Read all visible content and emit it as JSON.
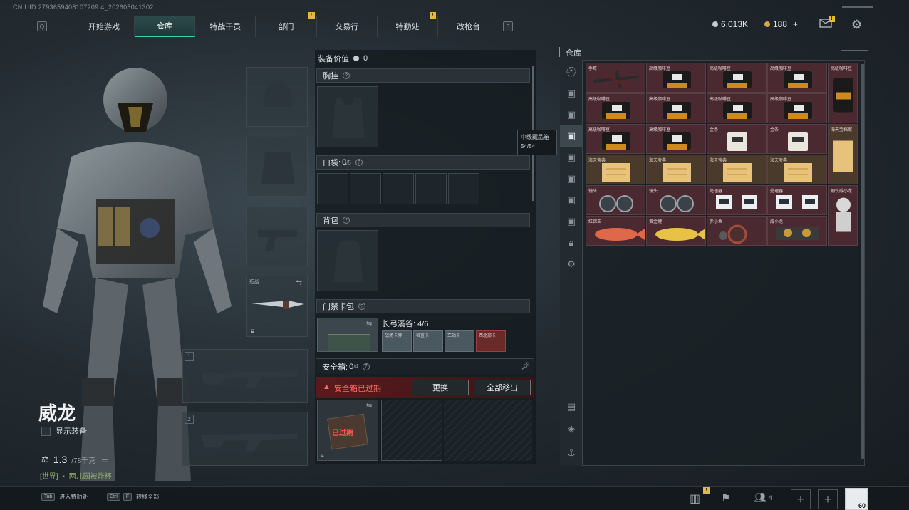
{
  "uid_text": "CN UID:2793659408107209 4_202605041302",
  "nav": {
    "left_key": "Q",
    "right_key": "E",
    "tabs": [
      {
        "label": "开始游戏",
        "badge": ""
      },
      {
        "label": "仓库",
        "badge": "",
        "active": true
      },
      {
        "label": "特战干员",
        "badge": ""
      },
      {
        "label": "部门",
        "badge": "!"
      },
      {
        "label": "交易行",
        "badge": ""
      },
      {
        "label": "特勤处",
        "badge": "!"
      },
      {
        "label": "改枪台",
        "badge": ""
      }
    ]
  },
  "currency": {
    "coins": "6,013K",
    "bonds": "188",
    "plus": "+",
    "mail_badge": "!"
  },
  "character": {
    "name": "威龙",
    "show_equipment_label": "显示装备",
    "weight_value": "1.3",
    "weight_max": "/78千克",
    "chat_channel": "[世界]",
    "chat_text": "两儿园被炸杯",
    "knife_label": "近战",
    "slot1_num": "1",
    "slot2_num": "2"
  },
  "middle": {
    "equipment_value_label": "装备价值",
    "equipment_value": "0",
    "chest_rig_label": "胸挂",
    "pockets_label": "口袋:",
    "pockets_value": "0",
    "pockets_max": "/5",
    "backpack_label": "背包",
    "keycard_label": "门禁卡包",
    "keycard_location": "长弓溪谷: 4/6",
    "keycards": [
      "战场卡牌",
      "检查卡",
      "车站卡",
      "西北部卡"
    ],
    "safe_box_label": "安全箱:",
    "safe_box_value": "0",
    "safe_box_max": "/4",
    "expired_text": "安全箱已过期",
    "replace_button": "更换",
    "remove_all_button": "全部移出",
    "expired_stamp": "已过期"
  },
  "tooltip": {
    "title": "中级藏品箱",
    "count": "54/54"
  },
  "inventory": {
    "title": "仓库",
    "rail_icons": [
      "helmet-icon",
      "box-icon-1",
      "box-icon-2",
      "box-icon-3",
      "box-icon-4",
      "box-icon-5",
      "box-icon-6",
      "box-icon-7",
      "lock-icon",
      "gear-icon"
    ],
    "rail_bottom_icons": [
      "profile-icon",
      "layers-icon",
      "anchor-icon"
    ],
    "items": [
      {
        "label": "手弩",
        "color": "red",
        "icon": "crossbow"
      },
      {
        "label": "高级咖啡豆",
        "color": "red",
        "icon": "coffee"
      },
      {
        "label": "高级咖啡豆",
        "color": "red",
        "icon": "coffee"
      },
      {
        "label": "高级咖啡豆",
        "color": "red",
        "icon": "coffee"
      },
      {
        "label": "高级咖啡豆",
        "color": "red",
        "icon": "coffee"
      },
      {
        "label": "高级咖啡豆",
        "color": "red",
        "icon": "coffee"
      },
      {
        "label": "高级咖啡豆",
        "color": "red",
        "icon": "coffee"
      },
      {
        "label": "高级咖啡豆",
        "color": "red",
        "icon": "coffee"
      },
      {
        "label": "高级咖啡豆",
        "color": "red",
        "icon": "coffee"
      },
      {
        "label": "高级咖啡豆",
        "color": "red",
        "icon": "coffee"
      },
      {
        "label": "金条",
        "color": "red",
        "icon": "bar"
      },
      {
        "label": "金条",
        "color": "red",
        "icon": "bar"
      },
      {
        "label": "海天宝典",
        "color": "amber",
        "icon": "paper"
      },
      {
        "label": "海天宝典",
        "color": "amber",
        "icon": "paper"
      },
      {
        "label": "海天宝典",
        "color": "amber",
        "icon": "paper"
      },
      {
        "label": "海天宝典",
        "color": "amber",
        "icon": "paper"
      },
      {
        "label": "镜头",
        "color": "red",
        "icon": "lens"
      },
      {
        "label": "镜头",
        "color": "red",
        "icon": "lens"
      },
      {
        "label": "处理器",
        "color": "red",
        "icon": "chip"
      },
      {
        "label": "处理器",
        "color": "red",
        "icon": "chip"
      },
      {
        "label": "红锦王",
        "color": "red",
        "icon": "fish-red"
      },
      {
        "label": "黄金鲤",
        "color": "red",
        "icon": "fish-gold"
      },
      {
        "label": "赤小鱼",
        "color": "red",
        "icon": "gear"
      },
      {
        "label": "威小龙",
        "color": "red",
        "icon": "dragon"
      },
      {
        "label": "高级咖啡豆",
        "color": "red",
        "icon": "coffee-tall"
      },
      {
        "label": "海天宝档案",
        "color": "amber",
        "icon": "paper-tall"
      },
      {
        "label": "钢铁威小龙",
        "color": "red",
        "icon": "figure"
      }
    ]
  },
  "bottom": {
    "tab_key": "Tab",
    "tab_label": "进入特勤处",
    "ctrl_key": "Ctrl",
    "f_key": "F",
    "ctrl_label": "转移全部",
    "squad_count": "4",
    "level": "60",
    "alert_badge": "!"
  }
}
